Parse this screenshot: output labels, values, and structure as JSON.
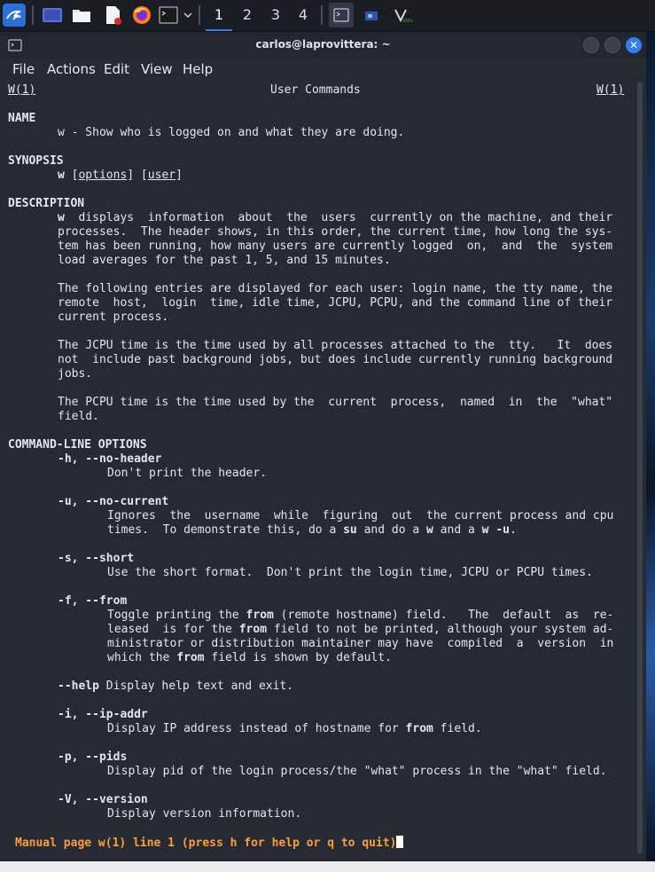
{
  "panel": {
    "workspaces": [
      "1",
      "2",
      "3",
      "4"
    ],
    "active_workspace": "1"
  },
  "window": {
    "title": "carlos@laprovittera: ~",
    "close_glyph": "✕"
  },
  "menu": [
    "File",
    "Actions",
    "Edit",
    "View",
    "Help"
  ],
  "man": {
    "header": {
      "left": "W(1)",
      "center": "User Commands",
      "right": "W(1)"
    },
    "sections": {
      "name": "NAME",
      "synopsis": "SYNOPSIS",
      "description": "DESCRIPTION",
      "options": "COMMAND-LINE OPTIONS"
    },
    "name_line": "w - Show who is logged on and what they are doing.",
    "synopsis": {
      "cmd": "w",
      "options": "options",
      "user": "user"
    },
    "description": [
      "w  displays  information  about  the  users  currently on the machine, and their",
      "processes.  The header shows, in this order, the current time, how long the sys-",
      "tem has been running, how many users are currently logged  on,  and  the  system",
      "load averages for the past 1, 5, and 15 minutes.",
      "The following entries are displayed for each user: login name, the tty name, the",
      "remote  host,  login  time, idle time, JCPU, PCPU, and the command line of their",
      "current process.",
      "The JCPU time is the time used by all processes attached to the  tty.   It  does",
      "not  include past background jobs, but does include currently running background",
      "jobs.",
      "The PCPU time is the time used by the  current  process,  named  in  the  \"what\"",
      "field."
    ],
    "options": [
      {
        "flag": "-h, --no-header",
        "desc": [
          "Don't print the header."
        ]
      },
      {
        "flag": "-u, --no-current",
        "desc": [
          "Ignores  the  username  while  figuring  out  the current process and cpu",
          "times.  To demonstrate this, do a su and do a w and a w -u."
        ]
      },
      {
        "flag": "-s, --short",
        "desc": [
          "Use the short format.  Don't print the login time, JCPU or PCPU times."
        ]
      },
      {
        "flag": "-f, --from",
        "desc": [
          "Toggle printing the from (remote hostname) field.   The  default  as  re-",
          "leased  is for the from field to not be printed, although your system ad-",
          "ministrator or distribution maintainer may have  compiled  a  version  in",
          "which the from field is shown by default."
        ]
      },
      {
        "flag": "--help",
        "desc": [
          "Display help text and exit."
        ]
      },
      {
        "flag": "-i, --ip-addr",
        "desc": [
          "Display IP address instead of hostname for from field."
        ]
      },
      {
        "flag": "-p, --pids",
        "desc": [
          "Display pid of the login process/the \"what\" process in the \"what\" field."
        ]
      },
      {
        "flag": "-V, --version",
        "desc": [
          "Display version information."
        ]
      }
    ],
    "status_line": "Manual page w(1) line 1 (press h for help or q to quit)"
  },
  "colors": {
    "accent": "#367bf0",
    "status": "#ff9e3d",
    "terminal_bg": "#252a33"
  }
}
